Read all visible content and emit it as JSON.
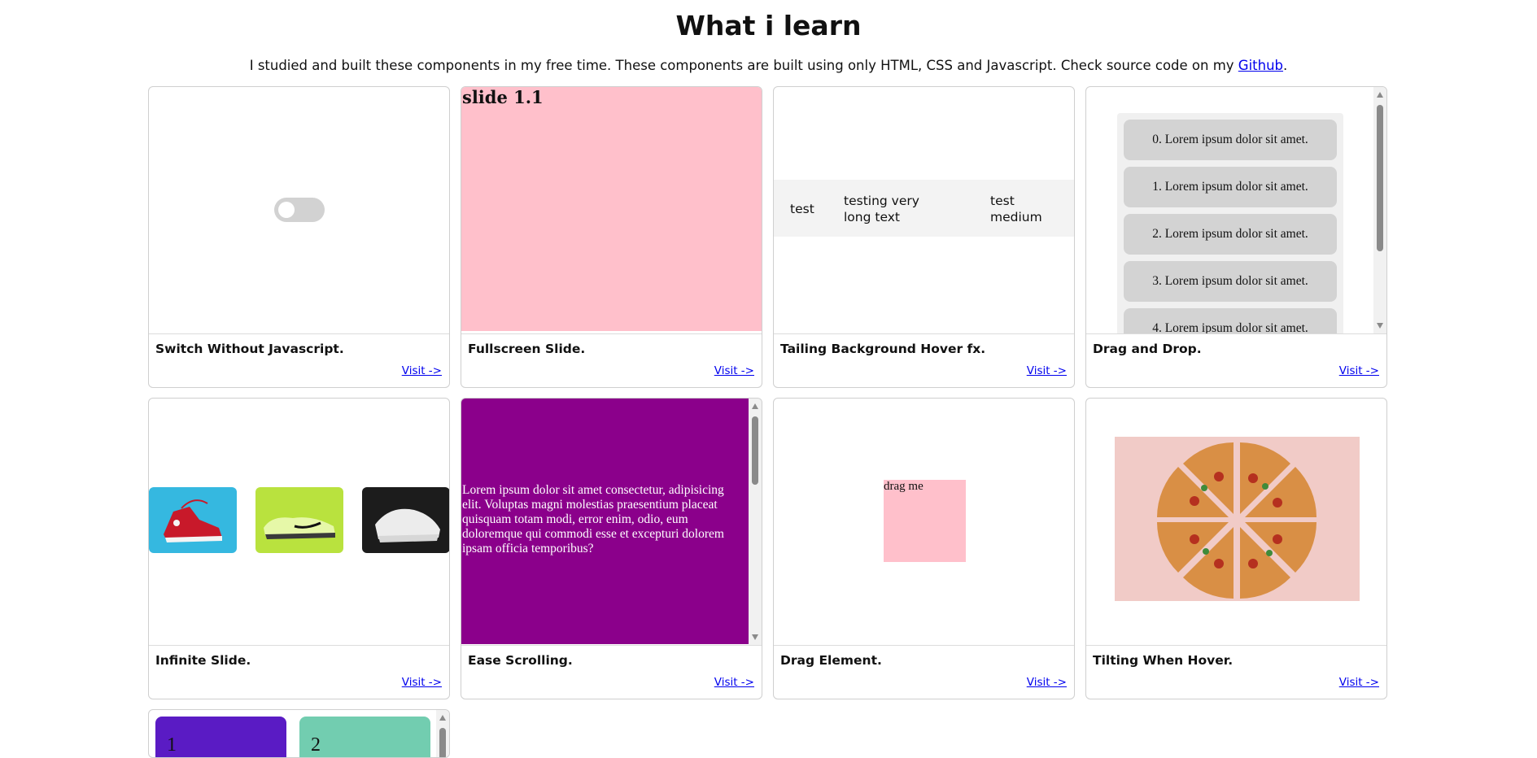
{
  "page": {
    "title": "What i learn",
    "intro": "I studied and built these components in my free time. These components are built using only HTML, CSS and Javascript. Check source code on my",
    "github_link": "Github",
    "intro_end": "."
  },
  "cards": [
    {
      "title": "Switch Without Javascript.",
      "link": "Visit ->"
    },
    {
      "title": "Fullscreen Slide.",
      "link": "Visit ->",
      "slide_label": "slide 1.1"
    },
    {
      "title": "Tailing Background Hover fx.",
      "link": "Visit ->",
      "cells": [
        "test",
        "testing very long text",
        "test medium"
      ]
    },
    {
      "title": "Drag and Drop.",
      "link": "Visit ->",
      "items": [
        "0. Lorem ipsum dolor sit amet.",
        "1. Lorem ipsum dolor sit amet.",
        "2. Lorem ipsum dolor sit amet.",
        "3. Lorem ipsum dolor sit amet.",
        "4. Lorem ipsum dolor sit amet."
      ]
    },
    {
      "title": "Infinite Slide.",
      "link": "Visit ->"
    },
    {
      "title": "Ease Scrolling.",
      "link": "Visit ->",
      "text": "Lorem ipsum dolor sit amet consectetur, adipisicing elit. Voluptas magni molestias praesentium placeat quisquam totam modi, error enim, odio, eum doloremque qui commodi esse et excepturi dolorem ipsam officia temporibus?"
    },
    {
      "title": "Drag Element.",
      "link": "Visit ->",
      "box_label": "drag me"
    },
    {
      "title": "Tilting When Hover.",
      "link": "Visit ->"
    }
  ],
  "partial_card": {
    "tiles": [
      "1",
      "2"
    ]
  },
  "colors": {
    "link": "#0000ee",
    "slide_bg": "#ffc0cb",
    "ease_bg": "#8b008b",
    "tile_purple": "#5a1bc4",
    "tile_green": "#72cdb0"
  }
}
